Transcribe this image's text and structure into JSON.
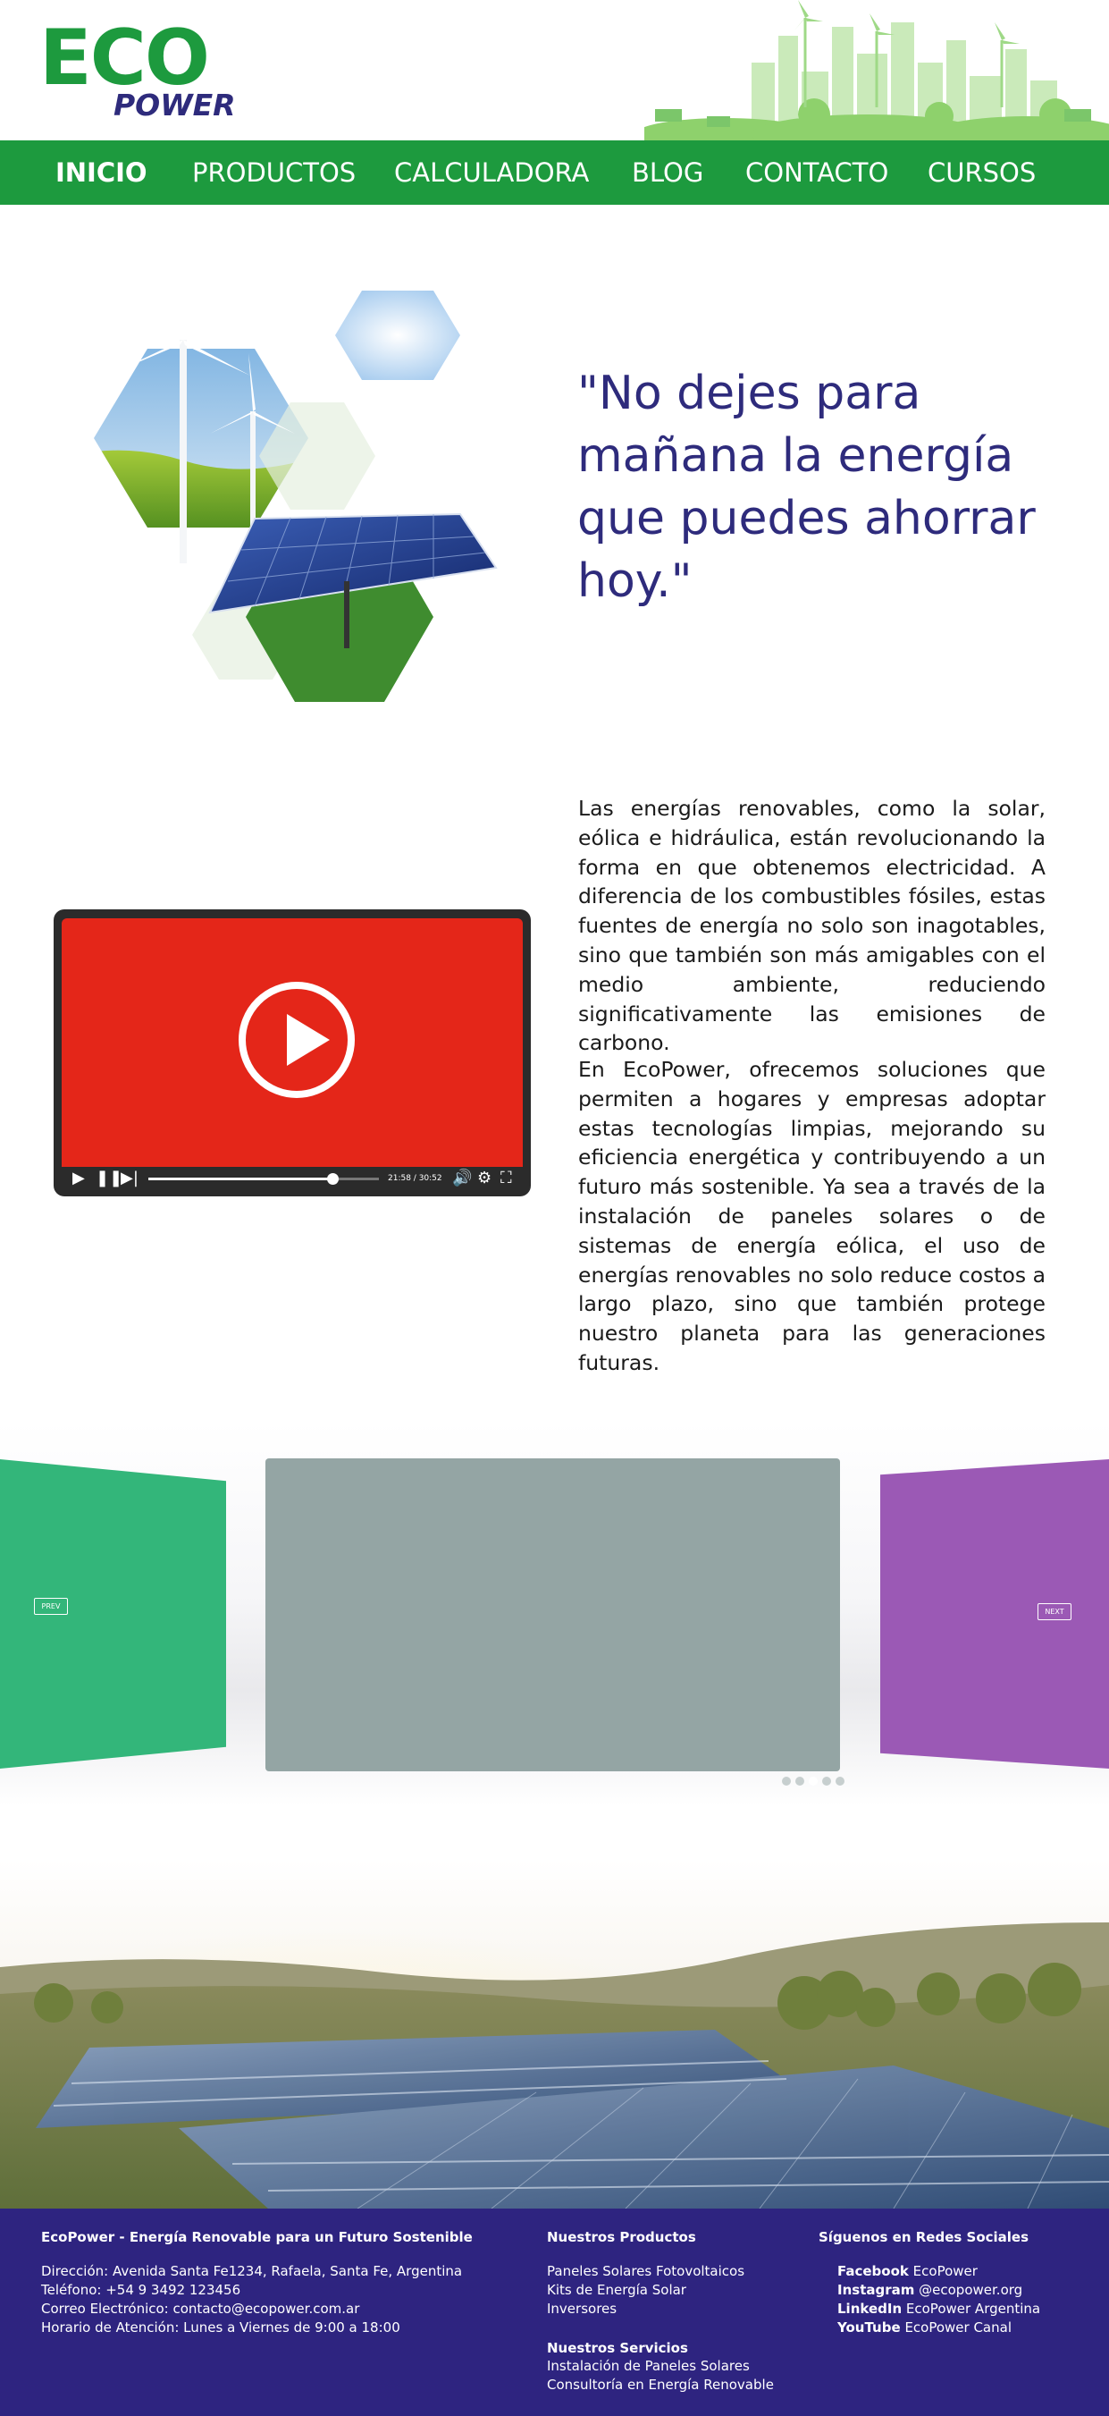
{
  "colors": {
    "brand_green": "#1d9a3e",
    "brand_purple": "#2e2b7c",
    "video_red": "#e42619",
    "footer_bg": "#2e2480",
    "slide_left": "#33b67a",
    "slide_center": "#94a5a4",
    "slide_right": "#9b59b5"
  },
  "logo": {
    "top": "ECO",
    "bottom": "POWER"
  },
  "nav": {
    "items": [
      {
        "label": "INICIO",
        "active": true
      },
      {
        "label": "PRODUCTOS",
        "active": false
      },
      {
        "label": "CALCULADORA",
        "active": false
      },
      {
        "label": "BLOG",
        "active": false
      },
      {
        "label": "CONTACTO",
        "active": false
      },
      {
        "label": "CURSOS",
        "active": false
      }
    ]
  },
  "hero": {
    "quote": "\"No dejes para mañana la energía que puedes ahorrar hoy.\""
  },
  "video": {
    "time": "21:58 / 30:52",
    "progress": 0.8,
    "icons": [
      "play-icon",
      "pause-icon",
      "next-icon",
      "volume-icon",
      "settings-icon",
      "fullscreen-icon"
    ]
  },
  "intro": {
    "paragraph1": "Las energías renovables, como la solar, eólica e hidráulica, están revolucionando la forma en que obtenemos electricidad. A diferencia de los combustibles fósiles, estas fuentes de energía no solo son inagotables, sino que también son más amigables con el medio ambiente, reduciendo significativamente las emisiones de carbono.",
    "paragraph2": "En EcoPower, ofrecemos soluciones que permiten a hogares y empresas adoptar estas tecnologías limpias, mejorando su eficiencia energética y contribuyendo a un futuro más sostenible. Ya sea a través de la instalación de paneles solares o de sistemas de energía eólica, el uso de energías renovables no solo reduce costos a largo plazo, sino que también protege nuestro planeta para las generaciones futuras."
  },
  "carousel": {
    "prev_label": "PREV",
    "next_label": "NEXT",
    "slide_count": 5,
    "active_index": 2
  },
  "footer": {
    "company": {
      "title": "EcoPower - Energía Renovable para un Futuro Sostenible",
      "address": "Dirección: Avenida Santa Fe1234, Rafaela, Santa Fe, Argentina",
      "phone": "Teléfono: +54 9 3492 123456",
      "email": "Correo Electrónico: contacto@ecopower.com.ar",
      "hours": "Horario de Atención: Lunes a Viernes de 9:00 a 18:00"
    },
    "products": {
      "title": "Nuestros Productos",
      "items": [
        "Paneles Solares Fotovoltaicos",
        "Kits de Energía Solar",
        "Inversores"
      ]
    },
    "services": {
      "title": "Nuestros Servicios",
      "items": [
        "Instalación de Paneles Solares",
        "Consultoría en Energía Renovable"
      ]
    },
    "social": {
      "title": "Síguenos en Redes Sociales",
      "items": [
        {
          "network": "Facebook",
          "handle": "EcoPower"
        },
        {
          "network": "Instagram",
          "handle": "@ecopower.org"
        },
        {
          "network": "LinkedIn",
          "handle": "EcoPower Argentina"
        },
        {
          "network": "YouTube",
          "handle": "EcoPower Canal"
        }
      ]
    }
  }
}
